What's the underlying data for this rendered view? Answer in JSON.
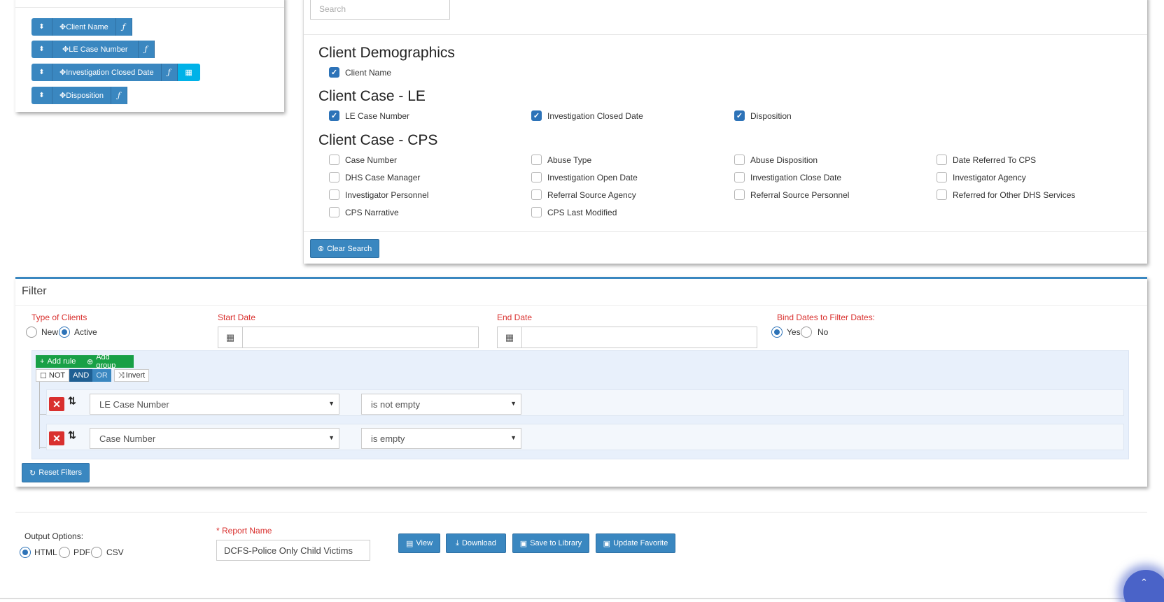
{
  "columns": {
    "items": [
      {
        "label": "Client Name",
        "has_calendar": false
      },
      {
        "label": "LE Case Number",
        "has_calendar": false
      },
      {
        "label": "Investigation Closed Date",
        "has_calendar": true
      },
      {
        "label": "Disposition",
        "has_calendar": false
      }
    ],
    "arrow_glyph": "⬍",
    "move_glyph": "✥",
    "fx_glyph": "ƒ",
    "calendar_glyph": "▦"
  },
  "fields": {
    "search_placeholder": "Search",
    "groups": [
      {
        "title": "Client Demographics",
        "fields": [
          {
            "label": "Client Name",
            "checked": true
          }
        ]
      },
      {
        "title": "Client Case - LE",
        "fields": [
          {
            "label": "LE Case Number",
            "checked": true
          },
          {
            "label": "Investigation Closed Date",
            "checked": true
          },
          {
            "label": "Disposition",
            "checked": true
          }
        ]
      },
      {
        "title": "Client Case - CPS",
        "fields": [
          {
            "label": "Case Number",
            "checked": false
          },
          {
            "label": "Abuse Type",
            "checked": false
          },
          {
            "label": "Abuse Disposition",
            "checked": false
          },
          {
            "label": "Date Referred To CPS",
            "checked": false
          },
          {
            "label": "DHS Case Manager",
            "checked": false
          },
          {
            "label": "Investigation Open Date",
            "checked": false
          },
          {
            "label": "Investigation Close Date",
            "checked": false
          },
          {
            "label": "Investigator Agency",
            "checked": false
          },
          {
            "label": "Investigator Personnel",
            "checked": false
          },
          {
            "label": "Referral Source Agency",
            "checked": false
          },
          {
            "label": "Referral Source Personnel",
            "checked": false
          },
          {
            "label": "Referred for Other DHS Services",
            "checked": false
          },
          {
            "label": "CPS Narrative",
            "checked": false
          },
          {
            "label": "CPS Last Modified",
            "checked": false
          }
        ]
      }
    ],
    "clear_search_label": "Clear Search",
    "check_glyph": "✓"
  },
  "filter": {
    "title": "Filter",
    "type_of_clients_label": "Type of Clients",
    "client_types": [
      {
        "label": "New",
        "selected": false
      },
      {
        "label": "Active",
        "selected": true
      }
    ],
    "start_date_label": "Start Date",
    "start_date_value": "",
    "end_date_label": "End Date",
    "end_date_value": "",
    "bind_dates_label": "Bind Dates to Filter Dates:",
    "bind_options": [
      {
        "label": "Yes",
        "selected": true
      },
      {
        "label": "No",
        "selected": false
      }
    ],
    "add_rule_label": "Add rule",
    "add_group_label": "Add group",
    "not_label": "NOT",
    "and_label": "AND",
    "or_label": "OR",
    "invert_label": "Invert",
    "rules": [
      {
        "field": "LE Case Number",
        "operator": "is not empty"
      },
      {
        "field": "Case Number",
        "operator": "is empty"
      }
    ],
    "reset_label": "Reset Filters"
  },
  "output": {
    "options_label": "Output Options:",
    "formats": [
      {
        "label": "HTML",
        "selected": true
      },
      {
        "label": "PDF",
        "selected": false
      },
      {
        "label": "CSV",
        "selected": false
      }
    ],
    "report_name_label": "* Report Name",
    "report_name_value": "DCFS-Police Only Child Victims",
    "view_label": "View",
    "download_label": "Download",
    "save_label": "Save to Library",
    "update_label": "Update Favorite"
  },
  "colors": {
    "primary": "#3a87c0",
    "info": "#00b2e8",
    "success": "#18a046",
    "danger": "#d9302e",
    "label_red": "#d9302e"
  }
}
